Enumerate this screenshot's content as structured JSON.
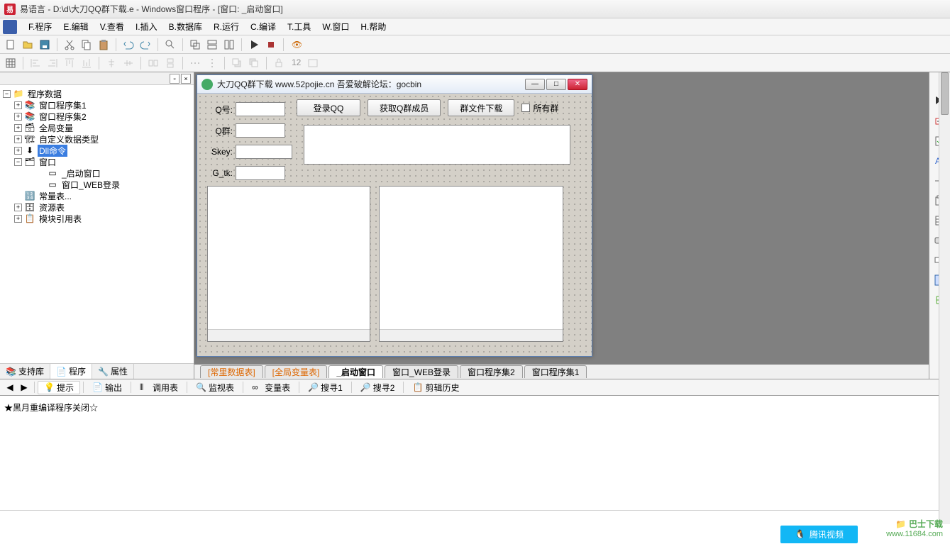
{
  "titlebar": {
    "app_name": "易语言",
    "path": "D:\\d\\大刀QQ群下载.e",
    "subtitle": "Windows窗口程序",
    "window_name": "[窗口: _启动窗口]"
  },
  "menu": {
    "program": "F.程序",
    "edit": "E.编辑",
    "view": "V.查看",
    "insert": "I.插入",
    "database": "B.数据库",
    "run": "R.运行",
    "compile": "C.编译",
    "tools": "T.工具",
    "window": "W.窗口",
    "help": "H.帮助"
  },
  "tree": {
    "root": "程序数据",
    "items": [
      {
        "label": "窗口程序集1",
        "icon": "stack"
      },
      {
        "label": "窗口程序集2",
        "icon": "stack"
      },
      {
        "label": "全局变量",
        "icon": "box"
      },
      {
        "label": "自定义数据类型",
        "icon": "struct"
      },
      {
        "label": "Dll命令",
        "icon": "arrow",
        "selected": true
      },
      {
        "label": "窗口",
        "icon": "folder",
        "expanded": true
      },
      {
        "label": "_启动窗口",
        "icon": "form",
        "indent": 2
      },
      {
        "label": "窗口_WEB登录",
        "icon": "form",
        "indent": 2
      },
      {
        "label": "常量表...",
        "icon": "const"
      },
      {
        "label": "资源表",
        "icon": "res"
      },
      {
        "label": "模块引用表",
        "icon": "mod"
      }
    ]
  },
  "left_tabs": {
    "support": "支持库",
    "program": "程序",
    "property": "属性"
  },
  "child_window": {
    "title": "大刀QQ群下载 www.52pojie.cn 吾爱破解论坛：gocbin",
    "labels": {
      "qq": "Q号:",
      "qgroup": "Q群:",
      "skey": "Skey:",
      "gtk": "G_tk:"
    },
    "buttons": {
      "login": "登录QQ",
      "get_members": "获取Q群成员",
      "group_files": "群文件下载",
      "all_groups": "所有群"
    }
  },
  "design_tabs": {
    "const_table": "[常里数据表]",
    "global_var": "[全局变量表]",
    "start_window": "_启动窗口",
    "web_login": "窗口_WEB登录",
    "progset2": "窗口程序集2",
    "progset1": "窗口程序集1"
  },
  "bottom_tabs": {
    "hint": "提示",
    "output": "输出",
    "calltable": "调用表",
    "watch": "监视表",
    "vartable": "变量表",
    "search1": "搜寻1",
    "search2": "搜寻2",
    "clipboard": "剪辑历史"
  },
  "output": {
    "line1": "★黑月重编译程序关闭☆"
  },
  "external": {
    "tencent_video": "腾讯视频",
    "watermark_name": "巴士下载",
    "watermark_url": "www.11684.com"
  }
}
